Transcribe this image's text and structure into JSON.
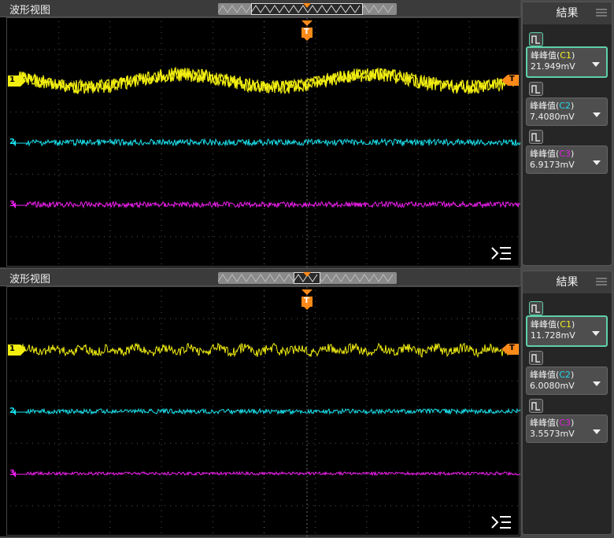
{
  "colors": {
    "ch1": "#f2ee10",
    "ch2": "#18e3ef",
    "ch3": "#f01ef0",
    "trigger": "#ff8a1a",
    "accent": "#5fd0a8"
  },
  "icons": {
    "menu": "menu-icon",
    "measure": "measure-pulse-icon",
    "dropdown": "dropdown-arrow-icon"
  },
  "panels": [
    {
      "title": "波形视图",
      "ch1_wave": "sine",
      "results_title": "結果",
      "markers": {
        "ch1": "1",
        "ch2": "2",
        "ch3": "3",
        "trigger": "T"
      },
      "measurements": [
        {
          "prefix": "峰峰值(",
          "ch": "C1",
          "suffix": ")",
          "value": "21.949mV"
        },
        {
          "prefix": "峰峰值(",
          "ch": "C2",
          "suffix": ")",
          "value": "7.4080mV"
        },
        {
          "prefix": "峰峰值(",
          "ch": "C3",
          "suffix": ")",
          "value": "6.9173mV"
        }
      ]
    },
    {
      "title": "波形视图",
      "ch1_wave": "ripple",
      "results_title": "結果",
      "markers": {
        "ch1": "1",
        "ch2": "2",
        "ch3": "3",
        "trigger": "T"
      },
      "measurements": [
        {
          "prefix": "峰峰值(",
          "ch": "C1",
          "suffix": ")",
          "value": "11.728mV"
        },
        {
          "prefix": "峰峰值(",
          "ch": "C2",
          "suffix": ")",
          "value": "6.0080mV"
        },
        {
          "prefix": "峰峰值(",
          "ch": "C3",
          "suffix": ")",
          "value": "3.5573mV"
        }
      ]
    }
  ]
}
